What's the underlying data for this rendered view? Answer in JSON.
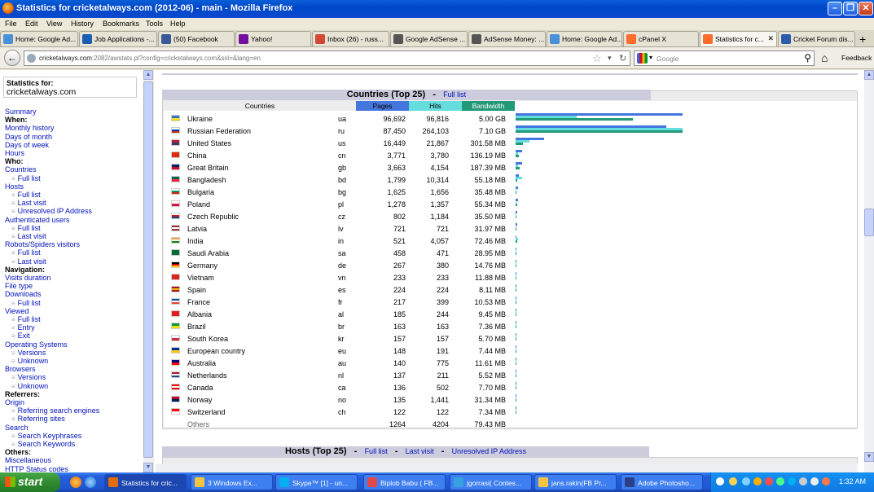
{
  "window": {
    "title": "Statistics for cricketalways.com (2012-06) - main - Mozilla Firefox"
  },
  "menu": [
    "File",
    "Edit",
    "View",
    "History",
    "Bookmarks",
    "Tools",
    "Help"
  ],
  "tabs": [
    {
      "label": "Home: Google Ad...",
      "icon_color": "#4a90d9"
    },
    {
      "label": "Job Applications -...",
      "icon_color": "#1a5fb4"
    },
    {
      "label": "(50) Facebook",
      "icon_color": "#3b5998"
    },
    {
      "label": "Yahoo!",
      "icon_color": "#720e9e"
    },
    {
      "label": "Inbox (26) - russ...",
      "icon_color": "#d14836"
    },
    {
      "label": "Google AdSense ...",
      "icon_color": "#555555"
    },
    {
      "label": "AdSense Money: ...",
      "icon_color": "#555555"
    },
    {
      "label": "Home: Google Ad...",
      "icon_color": "#4a90d9"
    },
    {
      "label": "cPanel X",
      "icon_color": "#ff6c2c"
    },
    {
      "label": "Statistics for c...",
      "icon_color": "#ff6c2c"
    },
    {
      "label": "Cricket Forum dis...",
      "icon_color": "#2a5caa"
    }
  ],
  "nav": {
    "url_host": "cricketalways.com",
    "url_rest": ":2082/awstats.pl?config=cricketalways.com&ssl=&lang=en",
    "search_placeholder": "Google",
    "feedback": "Feedback"
  },
  "sidebar": {
    "stats_for": "Statistics for:",
    "domain": "cricketalways.com",
    "items": [
      {
        "label": "Summary",
        "kind": "link"
      },
      {
        "label": "When:",
        "kind": "head"
      },
      {
        "label": "Monthly history",
        "kind": "link"
      },
      {
        "label": "Days of month",
        "kind": "link"
      },
      {
        "label": "Days of week",
        "kind": "link"
      },
      {
        "label": "Hours",
        "kind": "link"
      },
      {
        "label": "Who:",
        "kind": "head"
      },
      {
        "label": "Countries",
        "kind": "link"
      },
      {
        "label": "Full list",
        "kind": "sub"
      },
      {
        "label": "Hosts",
        "kind": "link"
      },
      {
        "label": "Full list",
        "kind": "sub"
      },
      {
        "label": "Last visit",
        "kind": "sub"
      },
      {
        "label": "Unresolved IP Address",
        "kind": "sub"
      },
      {
        "label": "Authenticated users",
        "kind": "link"
      },
      {
        "label": "Full list",
        "kind": "sub"
      },
      {
        "label": "Last visit",
        "kind": "sub"
      },
      {
        "label": "Robots/Spiders visitors",
        "kind": "link"
      },
      {
        "label": "Full list",
        "kind": "sub"
      },
      {
        "label": "Last visit",
        "kind": "sub"
      },
      {
        "label": "Navigation:",
        "kind": "head"
      },
      {
        "label": "Visits duration",
        "kind": "link"
      },
      {
        "label": "File type",
        "kind": "link"
      },
      {
        "label": "Downloads",
        "kind": "link"
      },
      {
        "label": "Full list",
        "kind": "sub"
      },
      {
        "label": "Viewed",
        "kind": "link"
      },
      {
        "label": "Full list",
        "kind": "sub"
      },
      {
        "label": "Entry",
        "kind": "sub"
      },
      {
        "label": "Exit",
        "kind": "sub"
      },
      {
        "label": "Operating Systems",
        "kind": "link"
      },
      {
        "label": "Versions",
        "kind": "sub"
      },
      {
        "label": "Unknown",
        "kind": "sub"
      },
      {
        "label": "Browsers",
        "kind": "link"
      },
      {
        "label": "Versions",
        "kind": "sub"
      },
      {
        "label": "Unknown",
        "kind": "sub"
      },
      {
        "label": "Referrers:",
        "kind": "head"
      },
      {
        "label": "Origin",
        "kind": "link"
      },
      {
        "label": "Referring search engines",
        "kind": "sub"
      },
      {
        "label": "Referring sites",
        "kind": "sub"
      },
      {
        "label": "Search",
        "kind": "link"
      },
      {
        "label": "Search Keyphrases",
        "kind": "sub"
      },
      {
        "label": "Search Keywords",
        "kind": "sub"
      },
      {
        "label": "Others:",
        "kind": "head"
      },
      {
        "label": "Miscellaneous",
        "kind": "link"
      },
      {
        "label": "HTTP Status codes",
        "kind": "link"
      }
    ]
  },
  "countries": {
    "title": "Countries (Top 25)",
    "full_list": "Full list",
    "sep": "-",
    "headers": {
      "countries": "Countries",
      "pages": "Pages",
      "hits": "Hits",
      "bandwidth": "Bandwidth"
    },
    "colors": {
      "pages": "#4477dd",
      "hits": "#66dddd",
      "bandwidth": "#229977"
    },
    "rows": [
      {
        "name": "Ukraine",
        "code": "ua",
        "pages": "96,692",
        "hits": "96,816",
        "bw": "5.00 GB",
        "p": 96692,
        "h": 96816,
        "b": 5120,
        "flag": [
          "#3a75c4",
          "#f9dd16"
        ]
      },
      {
        "name": "Russian Federation",
        "code": "ru",
        "pages": "87,450",
        "hits": "264,103",
        "bw": "7.10 GB",
        "p": 87450,
        "h": 264103,
        "b": 7270,
        "flag": [
          "#ffffff",
          "#0039a6",
          "#d52b1e"
        ]
      },
      {
        "name": "United States",
        "code": "us",
        "pages": "16,449",
        "hits": "21,867",
        "bw": "301.58 MB",
        "p": 16449,
        "h": 21867,
        "b": 301.58,
        "flag": [
          "#b22234",
          "#3c3b6e"
        ]
      },
      {
        "name": "China",
        "code": "cn",
        "pages": "3,771",
        "hits": "3,780",
        "bw": "136.19 MB",
        "p": 3771,
        "h": 3780,
        "b": 136.19,
        "flag": [
          "#de2910"
        ]
      },
      {
        "name": "Great Britain",
        "code": "gb",
        "pages": "3,663",
        "hits": "4,154",
        "bw": "187.39 MB",
        "p": 3663,
        "h": 4154,
        "b": 187.39,
        "flag": [
          "#012169",
          "#c8102e"
        ]
      },
      {
        "name": "Bangladesh",
        "code": "bd",
        "pages": "1,799",
        "hits": "10,314",
        "bw": "55.18 MB",
        "p": 1799,
        "h": 10314,
        "b": 55.18,
        "flag": [
          "#006a4e",
          "#f42a41"
        ]
      },
      {
        "name": "Bulgaria",
        "code": "bg",
        "pages": "1,625",
        "hits": "1,656",
        "bw": "35.48 MB",
        "p": 1625,
        "h": 1656,
        "b": 35.48,
        "flag": [
          "#ffffff",
          "#00966e",
          "#d62612"
        ]
      },
      {
        "name": "Poland",
        "code": "pl",
        "pages": "1,278",
        "hits": "1,357",
        "bw": "55.34 MB",
        "p": 1278,
        "h": 1357,
        "b": 55.34,
        "flag": [
          "#ffffff",
          "#dc143c"
        ]
      },
      {
        "name": "Czech Republic",
        "code": "cz",
        "pages": "802",
        "hits": "1,184",
        "bw": "35.50 MB",
        "p": 802,
        "h": 1184,
        "b": 35.5,
        "flag": [
          "#ffffff",
          "#d7141a",
          "#11457e"
        ]
      },
      {
        "name": "Latvia",
        "code": "lv",
        "pages": "721",
        "hits": "721",
        "bw": "31.97 MB",
        "p": 721,
        "h": 721,
        "b": 31.97,
        "flag": [
          "#9e3039",
          "#ffffff",
          "#9e3039"
        ]
      },
      {
        "name": "India",
        "code": "in",
        "pages": "521",
        "hits": "4,057",
        "bw": "72.46 MB",
        "p": 521,
        "h": 4057,
        "b": 72.46,
        "flag": [
          "#ff9933",
          "#ffffff",
          "#138808"
        ]
      },
      {
        "name": "Saudi Arabia",
        "code": "sa",
        "pages": "458",
        "hits": "471",
        "bw": "28.95 MB",
        "p": 458,
        "h": 471,
        "b": 28.95,
        "flag": [
          "#006c35"
        ]
      },
      {
        "name": "Germany",
        "code": "de",
        "pages": "267",
        "hits": "380",
        "bw": "14.76 MB",
        "p": 267,
        "h": 380,
        "b": 14.76,
        "flag": [
          "#000000",
          "#dd0000",
          "#ffce00"
        ]
      },
      {
        "name": "Vietnam",
        "code": "vn",
        "pages": "233",
        "hits": "233",
        "bw": "11.88 MB",
        "p": 233,
        "h": 233,
        "b": 11.88,
        "flag": [
          "#da251d"
        ]
      },
      {
        "name": "Spain",
        "code": "es",
        "pages": "224",
        "hits": "224",
        "bw": "8.11 MB",
        "p": 224,
        "h": 224,
        "b": 8.11,
        "flag": [
          "#aa151b",
          "#f1bf00",
          "#aa151b"
        ]
      },
      {
        "name": "France",
        "code": "fr",
        "pages": "217",
        "hits": "399",
        "bw": "10.53 MB",
        "p": 217,
        "h": 399,
        "b": 10.53,
        "flag": [
          "#0055a4",
          "#ffffff",
          "#ef4135"
        ]
      },
      {
        "name": "Albania",
        "code": "al",
        "pages": "185",
        "hits": "244",
        "bw": "9.45 MB",
        "p": 185,
        "h": 244,
        "b": 9.45,
        "flag": [
          "#e41e20"
        ]
      },
      {
        "name": "Brazil",
        "code": "br",
        "pages": "163",
        "hits": "163",
        "bw": "7.36 MB",
        "p": 163,
        "h": 163,
        "b": 7.36,
        "flag": [
          "#009c3b",
          "#ffdf00"
        ]
      },
      {
        "name": "South Korea",
        "code": "kr",
        "pages": "157",
        "hits": "157",
        "bw": "5.70 MB",
        "p": 157,
        "h": 157,
        "b": 5.7,
        "flag": [
          "#ffffff",
          "#cd2e3a"
        ]
      },
      {
        "name": "European country",
        "code": "eu",
        "pages": "148",
        "hits": "191",
        "bw": "7.44 MB",
        "p": 148,
        "h": 191,
        "b": 7.44,
        "flag": [
          "#003399",
          "#ffcc00"
        ]
      },
      {
        "name": "Australia",
        "code": "au",
        "pages": "140",
        "hits": "775",
        "bw": "11.61 MB",
        "p": 140,
        "h": 775,
        "b": 11.61,
        "flag": [
          "#00008b",
          "#ff0000"
        ]
      },
      {
        "name": "Netherlands",
        "code": "nl",
        "pages": "137",
        "hits": "211",
        "bw": "5.52 MB",
        "p": 137,
        "h": 211,
        "b": 5.52,
        "flag": [
          "#ae1c28",
          "#ffffff",
          "#21468b"
        ]
      },
      {
        "name": "Canada",
        "code": "ca",
        "pages": "136",
        "hits": "502",
        "bw": "7.70 MB",
        "p": 136,
        "h": 502,
        "b": 7.7,
        "flag": [
          "#ff0000",
          "#ffffff",
          "#ff0000"
        ]
      },
      {
        "name": "Norway",
        "code": "no",
        "pages": "135",
        "hits": "1,441",
        "bw": "31.34 MB",
        "p": 135,
        "h": 1441,
        "b": 31.34,
        "flag": [
          "#ba0c2f",
          "#00205b"
        ]
      },
      {
        "name": "Switzerland",
        "code": "ch",
        "pages": "122",
        "hits": "122",
        "bw": "7.34 MB",
        "p": 122,
        "h": 122,
        "b": 7.34,
        "flag": [
          "#ff0000",
          "#ffffff"
        ]
      }
    ],
    "others": {
      "label": "Others",
      "pages": "1264",
      "hits": "4204",
      "bw": "79.43 MB"
    }
  },
  "hosts": {
    "title": "Hosts (Top 25)",
    "links": [
      "Full list",
      "Last visit",
      "Unresolved IP Address"
    ],
    "sep": "-"
  },
  "taskbar": {
    "start": "start",
    "tasks": [
      {
        "label": "Statistics for cric...",
        "icon_color": "#e26b0a",
        "active": true
      },
      {
        "label": "3 Windows Ex...",
        "icon_color": "#f5c542",
        "active": false
      },
      {
        "label": "Skype™ [1] - un...",
        "icon_color": "#00aff0",
        "active": false
      },
      {
        "label": "Biplob Babu ( FB...",
        "icon_color": "#e24a4a",
        "active": false
      },
      {
        "label": "jgorrasi( Contes...",
        "icon_color": "#39a0e0",
        "active": false
      },
      {
        "label": "jans.rakin(FB Pr...",
        "icon_color": "#f5c542",
        "active": false
      },
      {
        "label": "Adobe Photosho...",
        "icon_color": "#2c3e88",
        "active": false
      }
    ],
    "clock": "1:32 AM"
  }
}
